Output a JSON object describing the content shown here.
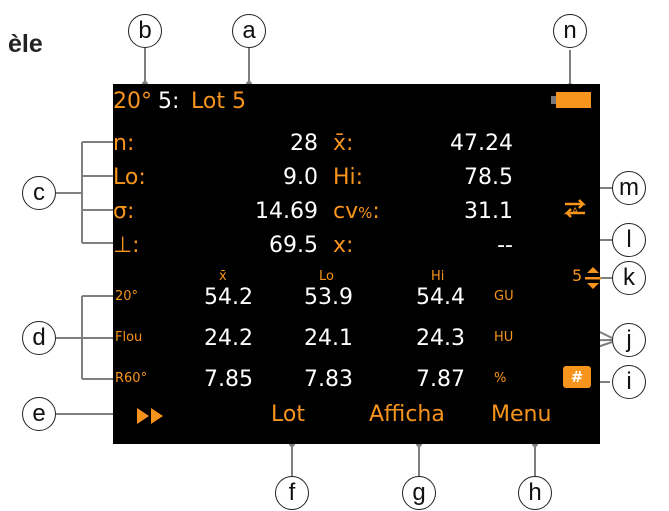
{
  "page_title_fragment": "èle",
  "callouts": [
    "a",
    "b",
    "c",
    "d",
    "e",
    "f",
    "g",
    "h",
    "i",
    "j",
    "k",
    "l",
    "m",
    "n"
  ],
  "header": {
    "angle": "20°",
    "number": "5:",
    "lot": "Lot 5"
  },
  "stats": {
    "n_label": "n:",
    "n_value": "28",
    "mean_label": "x̄:",
    "mean_value": "47.24",
    "lo_label": "Lo:",
    "lo_value": "9.0",
    "hi_label": "Hi:",
    "hi_value": "78.5",
    "sigma_label": "σ:",
    "sigma_value": "14.69",
    "cv_label": "cv",
    "cv_unit": "%",
    "cv_suffix": ":",
    "cv_value": "31.1",
    "range_label": "⊥:",
    "range_value": "69.5",
    "x_label": "x:",
    "x_value": "--"
  },
  "table": {
    "col_headers": [
      "x̄",
      "Lo",
      "Hi"
    ],
    "rows": [
      {
        "label": "20°",
        "values": [
          "54.2",
          "53.9",
          "54.4"
        ],
        "unit": "GU"
      },
      {
        "label": "Flou",
        "values": [
          "24.2",
          "24.1",
          "24.3"
        ],
        "unit": "HU"
      },
      {
        "label": "R60°",
        "values": [
          "7.85",
          "7.83",
          "7.87"
        ],
        "unit": "%"
      }
    ]
  },
  "step_value": "5",
  "footer": {
    "lot": "Lot",
    "affich": "Afficha",
    "menu": "Menu"
  },
  "colors": {
    "accent": "#f7941d",
    "screen": "#000000",
    "text": "#ffffff",
    "leader": "#7f7f7f"
  },
  "icons": [
    "battery-icon",
    "auto-cycle-icon",
    "step-arrows-icon",
    "hash-key-icon",
    "fast-forward-icon"
  ]
}
